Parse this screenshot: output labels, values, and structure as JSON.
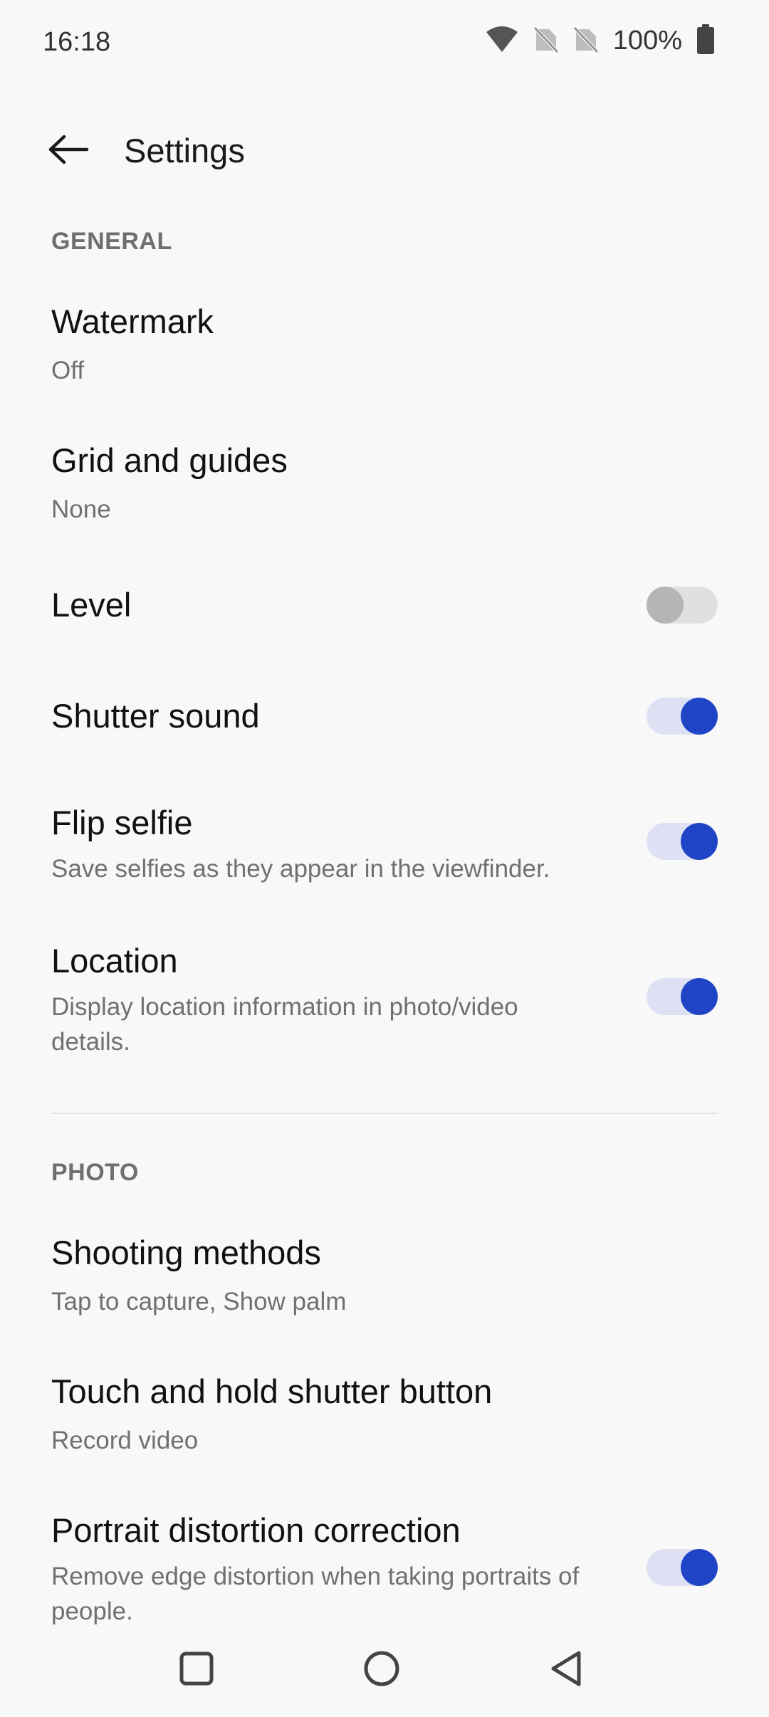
{
  "status_bar": {
    "time": "16:18",
    "battery_percent": "100%",
    "icons": [
      "wifi-icon",
      "no-sim-icon",
      "no-sim-icon",
      "battery-full-icon"
    ]
  },
  "app_bar": {
    "title": "Settings",
    "back_icon": "arrow-left-icon"
  },
  "sections": {
    "general": {
      "header": "GENERAL",
      "items": {
        "watermark": {
          "title": "Watermark",
          "subtitle": "Off"
        },
        "grid": {
          "title": "Grid and guides",
          "subtitle": "None"
        },
        "level": {
          "title": "Level",
          "toggle": false
        },
        "shutter_sound": {
          "title": "Shutter sound",
          "toggle": true
        },
        "flip_selfie": {
          "title": "Flip selfie",
          "subtitle": "Save selfies as they appear in the viewfinder.",
          "toggle": true
        },
        "location": {
          "title": "Location",
          "subtitle": "Display location information in photo/video details.",
          "toggle": true
        }
      }
    },
    "photo": {
      "header": "PHOTO",
      "items": {
        "shooting_methods": {
          "title": "Shooting methods",
          "subtitle": "Tap to capture, Show palm"
        },
        "touch_hold": {
          "title": "Touch and hold shutter button",
          "subtitle": "Record video"
        },
        "portrait_distortion": {
          "title": "Portrait distortion correction",
          "subtitle": "Remove edge distortion when taking portraits of people.",
          "toggle": true
        }
      }
    }
  },
  "colors": {
    "accent": "#1f45c6",
    "toggle_track_on": "#dde1f3",
    "background": "#f8f8f8"
  },
  "nav_bar": {
    "icons": [
      "recents-square-icon",
      "home-circle-icon",
      "back-triangle-icon"
    ]
  }
}
